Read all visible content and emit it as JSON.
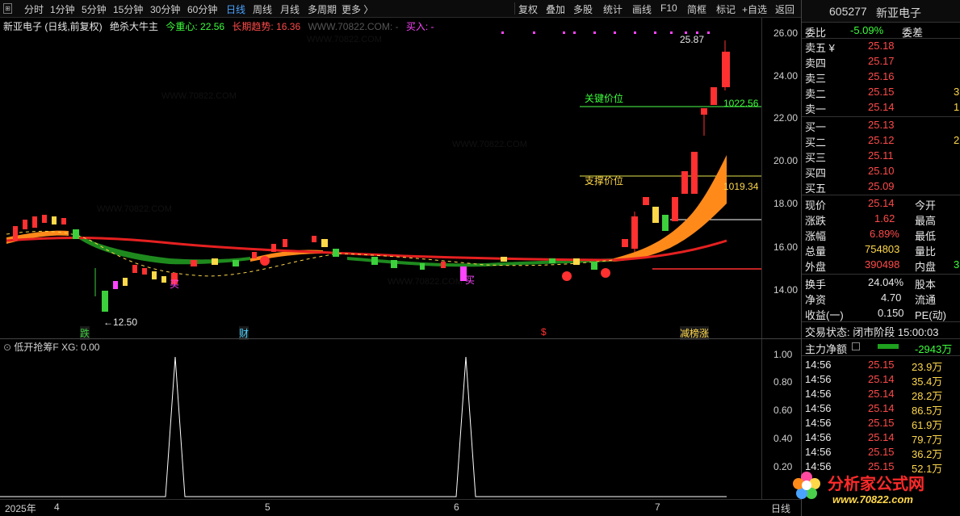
{
  "toolbar": {
    "periods": [
      "分时",
      "1分钟",
      "5分钟",
      "15分钟",
      "30分钟",
      "60分钟",
      "日线",
      "周线",
      "月线",
      "多周期",
      "更多 〉"
    ],
    "active_period": "日线",
    "tools": [
      "复权",
      "叠加",
      "多股",
      "统计",
      "画线",
      "F10",
      "简框",
      "标记",
      "+自选",
      "返回"
    ]
  },
  "main_header": {
    "title": "新亚电子 (日线,前复权)",
    "indicator_name": "绝杀大牛主",
    "center_label": "今重心: 22.56",
    "trend_label": "长期趋势: 16.36",
    "watermark_text": "WWW.70822.COM: -",
    "buy_label": "买入: -"
  },
  "main_chart": {
    "price_axis": [
      "26.00",
      "24.00",
      "22.00",
      "20.00",
      "18.00",
      "16.00",
      "14.00"
    ],
    "high_annotation": "25.87",
    "low_annotation": "←12.50",
    "key_price_label": "关键价位",
    "key_price_value": "1022.56",
    "support_price_label": "支撑价位",
    "support_price_value": "1019.34",
    "event_labels": [
      "跌",
      "财",
      "$",
      "减榜涨"
    ],
    "buy_markers": [
      "买",
      "买"
    ]
  },
  "sub_chart": {
    "header": "低开抢筹F  XG: 0.00",
    "axis": [
      "1.00",
      "0.80",
      "0.60",
      "0.40",
      "0.20"
    ]
  },
  "x_axis": {
    "labels": [
      "2025年",
      "4",
      "5",
      "6",
      "7"
    ],
    "mode": "日线"
  },
  "quote_panel": {
    "code": "605277",
    "name": "新亚电子",
    "wei_bi_label": "委比",
    "wei_bi_value": "-5.09%",
    "wei_cha_label": "委差",
    "asks": [
      {
        "label": "卖五 ¥",
        "price": "25.18"
      },
      {
        "label": "卖四",
        "price": "25.17"
      },
      {
        "label": "卖三",
        "price": "25.16"
      },
      {
        "label": "卖二",
        "price": "25.15",
        "vol": "3"
      },
      {
        "label": "卖一",
        "price": "25.14",
        "vol": "1"
      }
    ],
    "bids": [
      {
        "label": "买一",
        "price": "25.13"
      },
      {
        "label": "买二",
        "price": "25.12",
        "vol": "2"
      },
      {
        "label": "买三",
        "price": "25.11"
      },
      {
        "label": "买四",
        "price": "25.10"
      },
      {
        "label": "买五",
        "price": "25.09"
      }
    ],
    "stats": [
      {
        "label": "现价",
        "value": "25.14",
        "label2": "今开"
      },
      {
        "label": "涨跌",
        "value": "1.62",
        "label2": "最高"
      },
      {
        "label": "涨幅",
        "value": "6.89%",
        "label2": "最低"
      },
      {
        "label": "总量",
        "value": "754803",
        "label2": "量比"
      },
      {
        "label": "外盘",
        "value": "390498",
        "label2": "内盘",
        "value2": "3"
      }
    ],
    "stats2": [
      {
        "label": "换手",
        "value": "24.04%",
        "label2": "股本"
      },
      {
        "label": "净资",
        "value": "4.70",
        "label2": "流通"
      },
      {
        "label": "收益(一)",
        "value": "0.150",
        "label2": "PE(动)"
      }
    ],
    "status": "交易状态: 闭市阶段 15:00:03",
    "main_flow_label": "主力净额",
    "main_flow_value": "-2943万",
    "ticks": [
      {
        "time": "14:56",
        "price": "25.15",
        "vol": "23.9万",
        "color": "red"
      },
      {
        "time": "14:56",
        "price": "25.14",
        "vol": "35.4万",
        "color": "red"
      },
      {
        "time": "14:56",
        "price": "25.14",
        "vol": "28.2万",
        "color": "red"
      },
      {
        "time": "14:56",
        "price": "25.14",
        "vol": "86.5万",
        "color": "red"
      },
      {
        "time": "14:56",
        "price": "25.15",
        "vol": "61.9万",
        "color": "red"
      },
      {
        "time": "14:56",
        "price": "25.14",
        "vol": "79.7万",
        "color": "red"
      },
      {
        "time": "14:56",
        "price": "25.15",
        "vol": "36.2万",
        "color": "red"
      },
      {
        "time": "14:56",
        "price": "25.15",
        "vol": "52.1万",
        "color": "red"
      }
    ]
  },
  "watermark": {
    "site_name": "分析家公式网",
    "url": "www.70822.com"
  }
}
